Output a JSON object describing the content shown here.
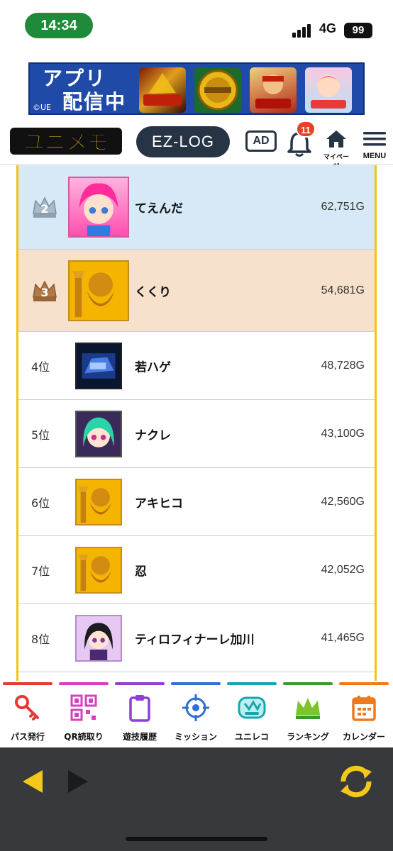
{
  "status_bar": {
    "time": "14:34",
    "network": "4G",
    "battery": "99"
  },
  "banner": {
    "line1": "アプリ",
    "line2": "配信中",
    "copyright": "©UE",
    "games": [
      "game-thumb-1",
      "game-thumb-2",
      "game-thumb-3",
      "game-thumb-4"
    ]
  },
  "header": {
    "logo_text": "ユニメモ",
    "ezlog_label": "EZ-LOG",
    "ad_label": "AD",
    "notification_count": "11",
    "mypage_label": "マイページ",
    "menu_label": "MENU"
  },
  "ranking": {
    "rows": [
      {
        "rank": "2",
        "label": "",
        "name": "てえんだ",
        "score": "62,751G",
        "style": "silver",
        "avatar": "pink-hair-avatar"
      },
      {
        "rank": "3",
        "label": "",
        "name": "くくり",
        "score": "54,681G",
        "style": "bronze",
        "avatar": "golden-statue-avatar"
      },
      {
        "rank": "4",
        "label": "4位",
        "name": "若ハゲ",
        "score": "48,728G",
        "style": "plain",
        "avatar": "blue-machine-avatar"
      },
      {
        "rank": "5",
        "label": "5位",
        "name": "ナクレ",
        "score": "43,100G",
        "style": "plain",
        "avatar": "green-hair-avatar"
      },
      {
        "rank": "6",
        "label": "6位",
        "name": "アキヒコ",
        "score": "42,560G",
        "style": "plain",
        "avatar": "golden-statue-avatar"
      },
      {
        "rank": "7",
        "label": "7位",
        "name": "忍",
        "score": "42,052G",
        "style": "plain",
        "avatar": "golden-statue-avatar"
      },
      {
        "rank": "8",
        "label": "8位",
        "name": "ティロフィナーレ加川",
        "score": "41,465G",
        "style": "plain",
        "avatar": "dark-hair-girl-avatar"
      }
    ]
  },
  "tabs": [
    {
      "label": "パス発行",
      "icon": "key-icon",
      "color": "#e53935"
    },
    {
      "label": "QR読取り",
      "icon": "qr-icon",
      "color": "#d63fbf"
    },
    {
      "label": "遊技履歴",
      "icon": "clipboard-icon",
      "color": "#8e3fd6"
    },
    {
      "label": "ミッション",
      "icon": "target-icon",
      "color": "#2f6fd6"
    },
    {
      "label": "ユニレコ",
      "icon": "unireco-icon",
      "color": "#18a5b0"
    },
    {
      "label": "ランキング",
      "icon": "crown-icon",
      "color": "#3a9a2a"
    },
    {
      "label": "カレンダー",
      "icon": "calendar-icon",
      "color": "#ee7a1e"
    }
  ],
  "colors": {
    "accent_yellow": "#f1c40f",
    "row_silver": "#d7e9f6",
    "row_bronze": "#f7e0cc",
    "nav_bg": "#38393d",
    "nav_arrow": "#f3c81a"
  }
}
